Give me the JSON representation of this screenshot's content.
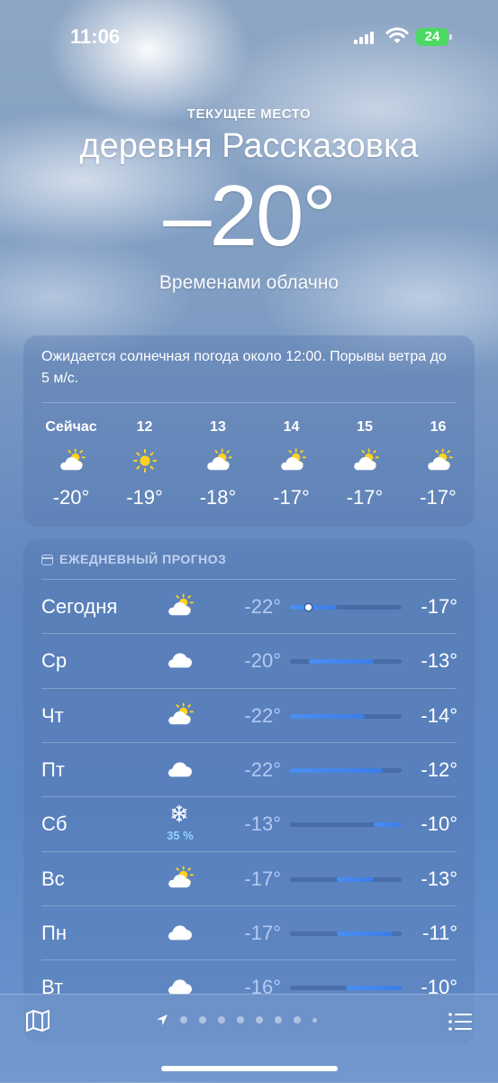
{
  "status": {
    "time": "11:06",
    "battery": "24"
  },
  "header": {
    "caption": "ТЕКУЩЕЕ МЕСТО",
    "location": "деревня Рассказовка",
    "temperature": "–20°",
    "condition": "Временами облачно"
  },
  "hourly": {
    "summary": "Ожидается солнечная погода около 12:00. Порывы ветра до 5 м/с.",
    "items": [
      {
        "label": "Сейчас",
        "icon": "partly-cloudy-icon",
        "temp": "-20°"
      },
      {
        "label": "12",
        "icon": "sun-icon",
        "temp": "-19°"
      },
      {
        "label": "13",
        "icon": "partly-cloudy-icon",
        "temp": "-18°"
      },
      {
        "label": "14",
        "icon": "partly-cloudy-icon",
        "temp": "-17°"
      },
      {
        "label": "15",
        "icon": "partly-cloudy-icon",
        "temp": "-17°"
      },
      {
        "label": "16",
        "icon": "partly-cloudy-icon",
        "temp": "-17°"
      }
    ]
  },
  "daily": {
    "title": "ЕЖЕДНЕВНЫЙ ПРОГНОЗ",
    "range_low": -22,
    "range_high": -10,
    "current_temp": -20,
    "days": [
      {
        "day": "Сегодня",
        "icon": "partly-cloudy-icon",
        "precip": "",
        "low": "-22°",
        "high": "-17°",
        "low_value": -22,
        "high_value": -17
      },
      {
        "day": "Ср",
        "icon": "cloud-icon",
        "precip": "",
        "low": "-20°",
        "high": "-13°",
        "low_value": -20,
        "high_value": -13
      },
      {
        "day": "Чт",
        "icon": "partly-cloudy-icon",
        "precip": "",
        "low": "-22°",
        "high": "-14°",
        "low_value": -22,
        "high_value": -14
      },
      {
        "day": "Пт",
        "icon": "cloud-icon",
        "precip": "",
        "low": "-22°",
        "high": "-12°",
        "low_value": -22,
        "high_value": -12
      },
      {
        "day": "Сб",
        "icon": "snowflake-icon",
        "precip": "35 %",
        "low": "-13°",
        "high": "-10°",
        "low_value": -13,
        "high_value": -10
      },
      {
        "day": "Вс",
        "icon": "partly-cloudy-icon",
        "precip": "",
        "low": "-17°",
        "high": "-13°",
        "low_value": -17,
        "high_value": -13
      },
      {
        "day": "Пн",
        "icon": "cloud-icon",
        "precip": "",
        "low": "-17°",
        "high": "-11°",
        "low_value": -17,
        "high_value": -11
      },
      {
        "day": "Вт",
        "icon": "cloud-icon",
        "precip": "",
        "low": "-16°",
        "high": "-10°",
        "low_value": -16,
        "high_value": -10
      }
    ]
  },
  "pager": {
    "page_count": 9,
    "current_page": 1
  }
}
